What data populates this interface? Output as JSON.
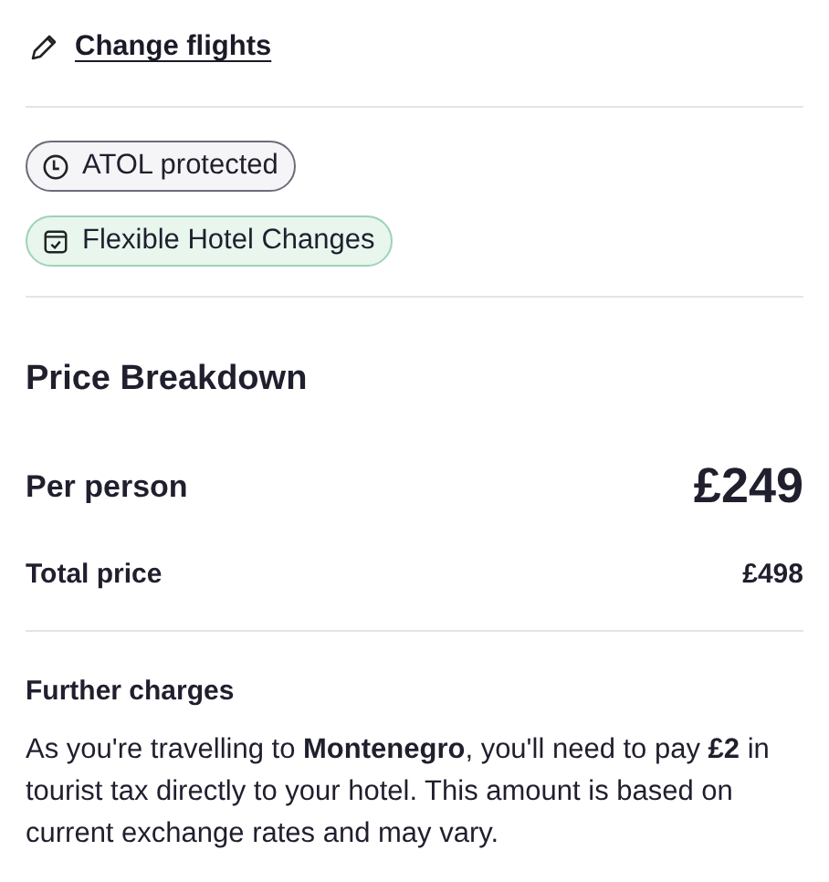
{
  "change_link": {
    "label": "Change flights"
  },
  "badges": [
    {
      "kind": "atol",
      "label": "ATOL protected"
    },
    {
      "kind": "flexible",
      "label": "Flexible Hotel Changes"
    }
  ],
  "price_breakdown": {
    "title": "Price Breakdown",
    "rows": [
      {
        "kind": "major",
        "label": "Per person",
        "value": "£249"
      },
      {
        "kind": "minor",
        "label": "Total price",
        "value": "£498"
      }
    ]
  },
  "further_charges": {
    "title": "Further charges",
    "text": "As you're travelling to **Montenegro**, you'll need to pay **£2** in tourist tax directly to your hotel. This amount is based on current exchange rates and may vary."
  }
}
